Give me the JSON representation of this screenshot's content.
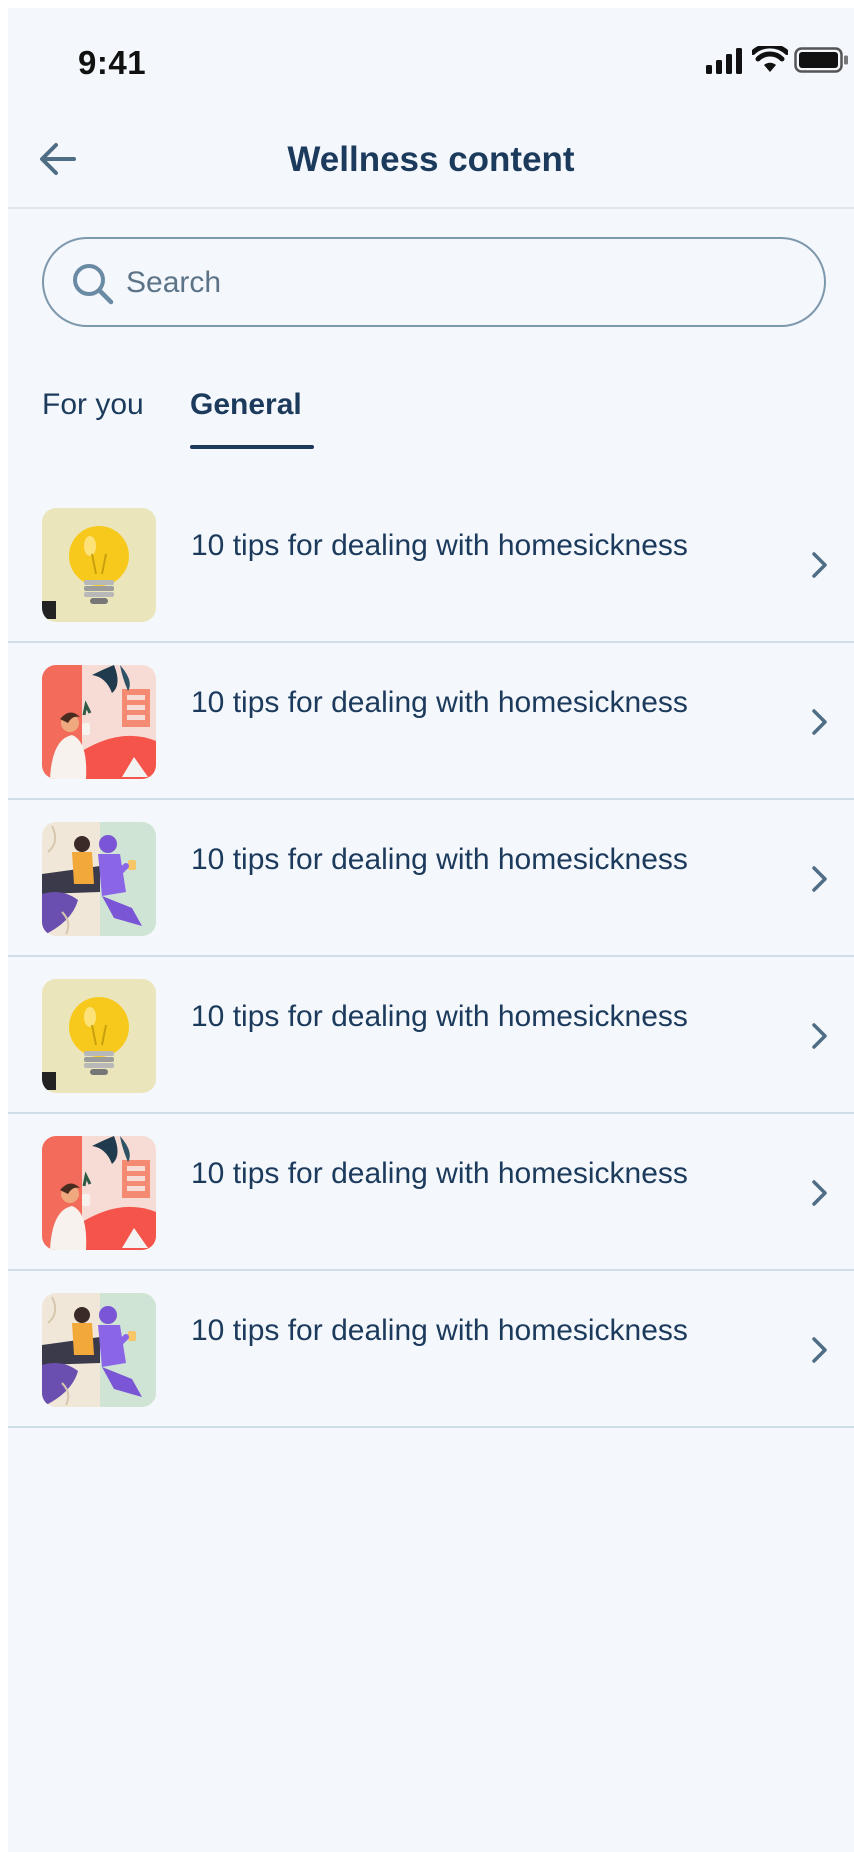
{
  "status_bar": {
    "time": "9:41",
    "icons": [
      "cellular-signal-icon",
      "wifi-icon",
      "battery-icon"
    ]
  },
  "header": {
    "back_icon": "back-arrow-icon",
    "title": "Wellness content"
  },
  "search": {
    "placeholder": "Search",
    "value": "",
    "icon": "search-icon"
  },
  "tabs": [
    {
      "label": "For you",
      "active": false
    },
    {
      "label": "General",
      "active": true
    }
  ],
  "articles": [
    {
      "title": "10 tips for dealing with homesickness",
      "thumbnail": "lightbulb-thumbnail"
    },
    {
      "title": "10 tips for dealing with homesickness",
      "thumbnail": "person-drinking-thumbnail"
    },
    {
      "title": "10 tips for dealing with homesickness",
      "thumbnail": "friends-illustration-thumbnail"
    },
    {
      "title": "10 tips for dealing with homesickness",
      "thumbnail": "lightbulb-thumbnail"
    },
    {
      "title": "10 tips for dealing with homesickness",
      "thumbnail": "person-drinking-thumbnail"
    },
    {
      "title": "10 tips for dealing with homesickness",
      "thumbnail": "friends-illustration-thumbnail"
    }
  ],
  "colors": {
    "background": "#f4f7fb",
    "primary_text": "#1b3a5c",
    "search_border": "#7d98ad",
    "divider": "#cfdde6",
    "chevron": "#4f6d85"
  }
}
